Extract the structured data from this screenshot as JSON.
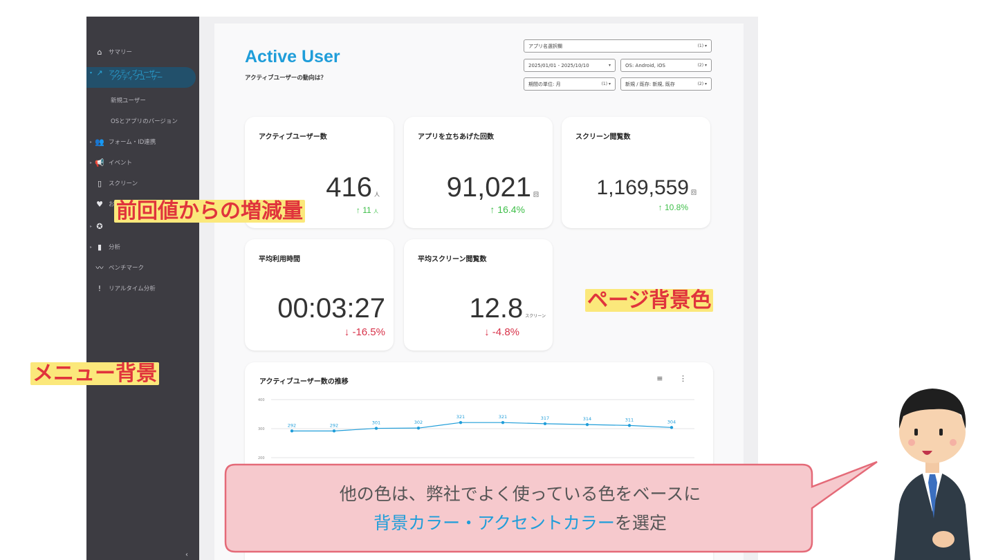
{
  "sidebar": {
    "items": [
      {
        "label": "サマリー",
        "icon": "home-icon"
      },
      {
        "label": "アクティブユーザー",
        "icon": "trend-icon"
      },
      {
        "label": "アクティブユーザー"
      },
      {
        "label": "新規ユーザー"
      },
      {
        "label": "OSとアプリのバージョン"
      },
      {
        "label": "フォーム・ID連携",
        "icon": "users-icon"
      },
      {
        "label": "イベント",
        "icon": "megaphone-icon"
      },
      {
        "label": "スクリーン",
        "icon": "phone-icon"
      },
      {
        "label": "お",
        "icon": "heart-icon"
      },
      {
        "label": "",
        "icon": "check-badge-icon"
      },
      {
        "label": "分析",
        "icon": "bar-chart-icon"
      },
      {
        "label": "ベンチマーク",
        "icon": "sparkline-icon"
      },
      {
        "label": "リアルタイム分析",
        "icon": "exclamation-icon"
      }
    ],
    "collapse_label": "‹"
  },
  "header": {
    "title": "Active User",
    "subtitle": "アクティブユーザーの動向は？"
  },
  "filters": {
    "app": {
      "label": "アプリ名選択欄",
      "count": "(1) ▾"
    },
    "date": {
      "label": "2025/01/01 - 2025/10/10",
      "count": "▾"
    },
    "os": {
      "label": "OS: Android, iOS",
      "count": "(2) ▾"
    },
    "period": {
      "label": "期間の単位: 月",
      "count": "(1) ▾"
    },
    "newexist": {
      "label": "新規 / 既存: 新規, 既存",
      "count": "(2) ▾"
    }
  },
  "cards": {
    "active_users": {
      "title": "アクティブユーザー数",
      "value": "416",
      "unit": "人",
      "delta": "↑ 11",
      "delta_unit": "人",
      "direction": "up"
    },
    "app_launches": {
      "title": "アプリを立ちあげた回数",
      "value": "91,021",
      "unit": "回",
      "delta": "↑ 16.4%",
      "direction": "up"
    },
    "screen_views": {
      "title": "スクリーン閲覧数",
      "value": "1,169,559",
      "unit": "回",
      "delta": "↑ 10.8%",
      "direction": "up"
    },
    "avg_time": {
      "title": "平均利用時間",
      "value": "00:03:27",
      "delta": "↓ -16.5%",
      "direction": "down"
    },
    "avg_screens": {
      "title": "平均スクリーン閲覧数",
      "value": "12.8",
      "unit": "スクリーン",
      "delta": "↓ -4.8%",
      "direction": "down"
    }
  },
  "chart": {
    "title": "アクティブユーザー数の推移",
    "tools": "≡ ⋮"
  },
  "chart_data": {
    "type": "line",
    "title": "アクティブユーザー数の推移",
    "y_ticks": [
      "400",
      "300",
      "200"
    ],
    "ylim": [
      200,
      400
    ],
    "values": [
      292,
      292,
      301,
      302,
      321,
      321,
      317,
      314,
      311,
      304
    ],
    "color": "#1f9dd9",
    "grid": true
  },
  "annotations": {
    "delta_note": "前回値からの増減量",
    "page_bg_note": "ページ背景色",
    "menu_bg_note": "メニュー背景"
  },
  "bubble": {
    "line1": "他の色は、弊社でよく使っている色をベースに",
    "line2_accent": "背景カラー・アクセントカラー",
    "line2_rest": "を選定"
  },
  "colors": {
    "sidebar_bg": "#3d3c42",
    "page_bg": "#efeff1",
    "accent": "#1f9dd9",
    "up": "#3fbf4a",
    "down": "#d8334a",
    "bubble_bg": "#f6c9cd",
    "bubble_border": "#e46a78",
    "annotation_bg": "#fbe87b",
    "annotation_text": "#e0343c"
  }
}
